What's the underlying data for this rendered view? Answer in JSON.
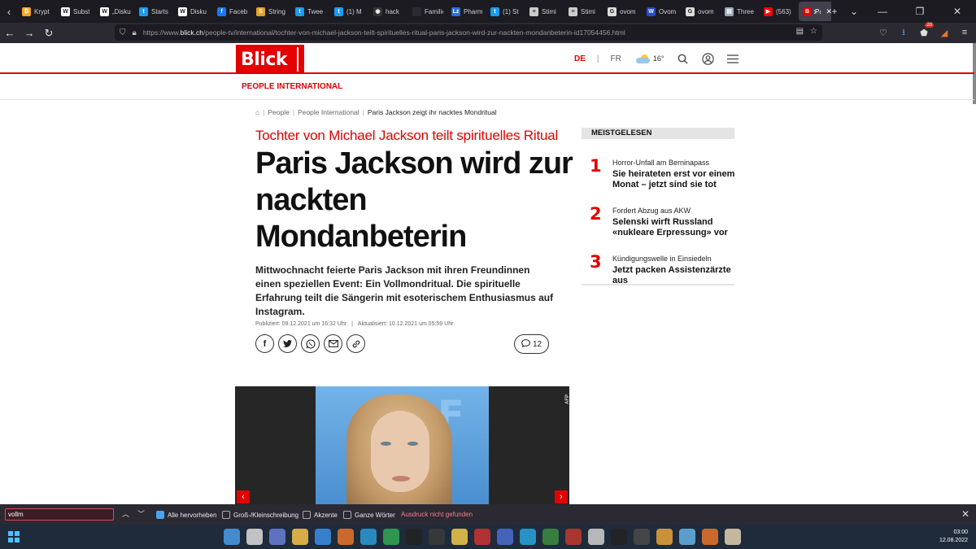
{
  "browser": {
    "tabs": [
      {
        "label": "Krypt",
        "color": "#f5a623",
        "glyph": "₿"
      },
      {
        "label": "Subst",
        "color": "#ffffff",
        "glyph": "W"
      },
      {
        "label": "„Disku",
        "color": "#ffffff",
        "glyph": "W"
      },
      {
        "label": "Starts",
        "color": "#1d9bf0",
        "glyph": "t"
      },
      {
        "label": "Disku",
        "color": "#ffffff",
        "glyph": "W"
      },
      {
        "label": "Faceb",
        "color": "#1877f2",
        "glyph": "f"
      },
      {
        "label": "String",
        "color": "#e0a22a",
        "glyph": "S"
      },
      {
        "label": "Twee",
        "color": "#1d9bf0",
        "glyph": "t"
      },
      {
        "label": "(1) M",
        "color": "#1d9bf0",
        "glyph": "t"
      },
      {
        "label": "hack",
        "color": "#333333",
        "glyph": "◉"
      },
      {
        "label": "Familien A",
        "color": "#2b2a33",
        "glyph": ""
      },
      {
        "label": "Pharm",
        "color": "#2d6cdf",
        "glyph": "Lz"
      },
      {
        "label": "(1) St",
        "color": "#1d9bf0",
        "glyph": "t"
      },
      {
        "label": "Stimi",
        "color": "#cccccc",
        "glyph": "≡"
      },
      {
        "label": "Stimi",
        "color": "#cccccc",
        "glyph": "≡"
      },
      {
        "label": "ovom",
        "color": "#dddddd",
        "glyph": "G"
      },
      {
        "label": "Ovom",
        "color": "#2b4cc8",
        "glyph": "W"
      },
      {
        "label": "ovom",
        "color": "#dddddd",
        "glyph": "G"
      },
      {
        "label": "Three",
        "color": "#9ab",
        "glyph": "▤"
      },
      {
        "label": "(563)",
        "color": "#ff0000",
        "glyph": "▶"
      },
      {
        "label": "Pa",
        "color": "#e20000",
        "glyph": "B",
        "active": true
      }
    ],
    "url_prefix": "https://www.",
    "url_domain": "blick.ch",
    "url_path": "/people-tv/international/tochter-von-michael-jackson-teilt-spirituelles-ritual-paris-jackson-wird-zur-nackten-mondanbeterin-id17054456.html",
    "badge_count": "20"
  },
  "site": {
    "logo": "Blick",
    "lang_de": "DE",
    "lang_sep": "|",
    "lang_fr": "FR",
    "temperature": "16°",
    "section": "PEOPLE INTERNATIONAL"
  },
  "breadcrumb": {
    "items": [
      "People",
      "People International"
    ],
    "current": "Paris Jackson zeigt ihr nacktes Mondritual",
    "sep": "|"
  },
  "article": {
    "kicker": "Tochter von Michael Jackson teilt spirituelles Ritual",
    "headline": "Paris Jackson wird zur nackten Mondanbeterin",
    "lead": "Mittwochnacht feierte Paris Jackson mit ihren Freundinnen einen speziellen Event: Ein Vollmondritual. Die spirituelle Erfahrung teilt die Sängerin mit esoterischem Enthusiasmus auf Instagram.",
    "published": "Publiziert: 09.12.2021 um 16:32 Uhr",
    "meta_sep": "|",
    "updated": "Aktualisiert: 10.12.2021 um 05:59 Uhr",
    "comments": "12",
    "photo_credit": "AFP"
  },
  "meistgelesen": {
    "title": "MEISTGELESEN",
    "items": [
      {
        "num": "1",
        "kicker": "Horror-Unfall am Berninapass",
        "title": "Sie heirateten erst vor einem Monat – jetzt sind sie tot"
      },
      {
        "num": "2",
        "kicker": "Fordert Abzug aus AKW",
        "title": "Selenski wirft Russland «nukleare Erpressung» vor"
      },
      {
        "num": "3",
        "kicker": "Kündigungswelle in Einsiedeln",
        "title": "Jetzt packen Assistenzärzte aus"
      }
    ]
  },
  "findbar": {
    "query": "vollm",
    "highlight_all": "Alle hervorheben",
    "match_case": "Groß-/Kleinschreibung",
    "accents": "Akzente",
    "whole_words": "Ganze Wörter",
    "status": "Ausdruck nicht gefunden"
  },
  "taskbar": {
    "time": "03:00",
    "date": "12.08.2022",
    "icons": [
      "#4b9be8",
      "#dddddd",
      "#6b7fd7",
      "#f6c34a",
      "#3a8ee6",
      "#e8742c",
      "#2d9bd7",
      "#34a853",
      "#222222",
      "#3b3b3b",
      "#f2c94c",
      "#cc3333",
      "#4a6fd0",
      "#2aa5e0",
      "#3c8d40",
      "#c0392b",
      "#d0d0d0",
      "#222222",
      "#4a4a4a",
      "#e8a33a",
      "#66b3e8",
      "#e8742c",
      "#e0d0b0"
    ]
  }
}
